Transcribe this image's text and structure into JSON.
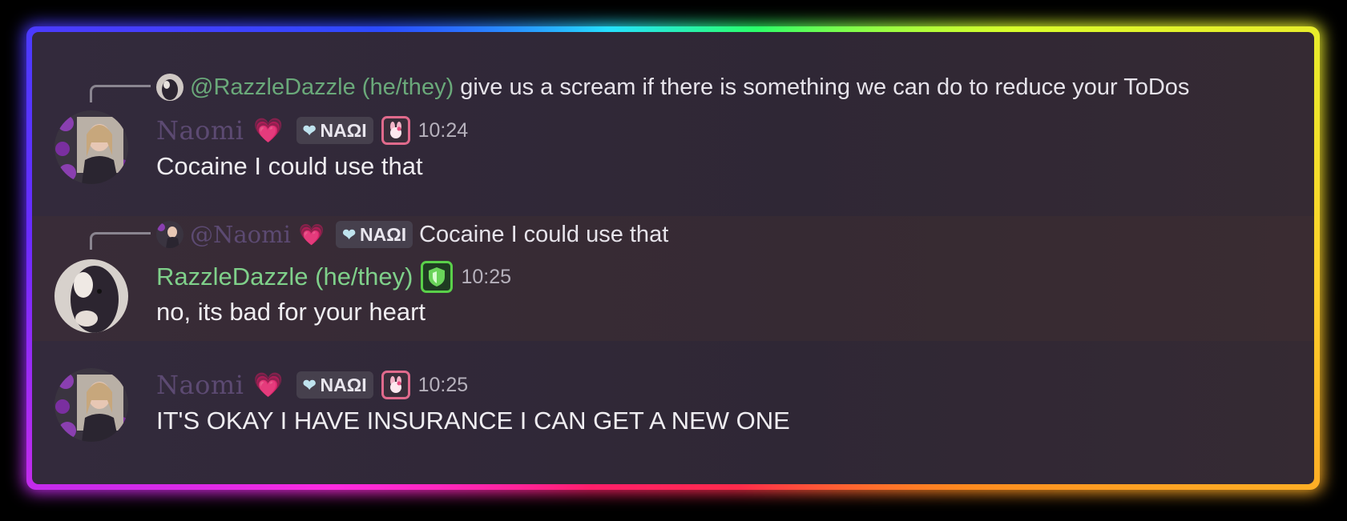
{
  "messages": [
    {
      "reply": {
        "author": "@RazzleDazzle (he/they)",
        "text": "give us a scream if there is something we can do to reduce your ToDos"
      },
      "author": "Naomi",
      "heart": "💗",
      "tag": "NAΩI",
      "time": "10:24",
      "text": "Cocaine I could use that"
    },
    {
      "reply": {
        "author": "@Naomi",
        "heart": "💗",
        "tag": "NAΩI",
        "text": "Cocaine I could use that"
      },
      "author": "RazzleDazzle (he/they)",
      "time": "10:25",
      "text": "no, its bad for your heart"
    },
    {
      "author": "Naomi",
      "heart": "💗",
      "tag": "NAΩI",
      "time": "10:25",
      "text": "IT'S OKAY I HAVE INSURANCE I CAN GET A NEW ONE"
    }
  ],
  "colors": {
    "naomi_name": "#5c4a72",
    "razzle_name": "#7fd08a",
    "background": "#2f2735"
  },
  "icons": [
    "heart-crystal-icon",
    "bunny-role-icon",
    "shield-role-icon",
    "reply-connector-icon"
  ]
}
